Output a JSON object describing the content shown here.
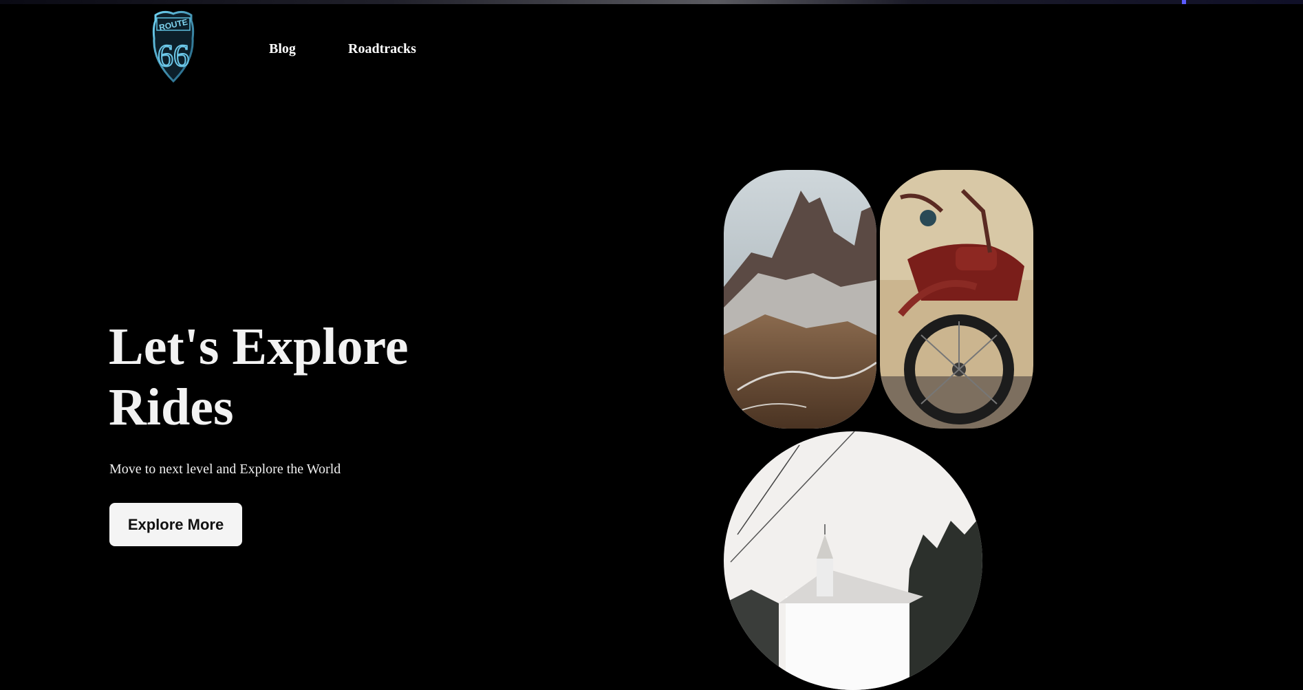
{
  "logo": {
    "text_top": "ROUTE",
    "text_number": "66",
    "icon": "route-66-shield-icon",
    "color": "#4fb3d9"
  },
  "nav": {
    "items": [
      {
        "label": "Blog"
      },
      {
        "label": "Roadtracks"
      }
    ]
  },
  "hero": {
    "title_line1": "Let's Explore",
    "title_line2": "Rides",
    "subtitle": "Move to next level and Explore the World",
    "button_label": "Explore More"
  },
  "gallery": {
    "images": [
      {
        "name": "mountain-photo",
        "subject": "rocky mountain peaks with snow"
      },
      {
        "name": "motorcycle-photo",
        "subject": "vintage red Indian motorcycle"
      },
      {
        "name": "church-photo",
        "subject": "white church with steeple in snow"
      }
    ]
  },
  "colors": {
    "background": "#000000",
    "text": "#ffffff",
    "button_bg": "#f4f4f4",
    "button_text": "#111111"
  }
}
